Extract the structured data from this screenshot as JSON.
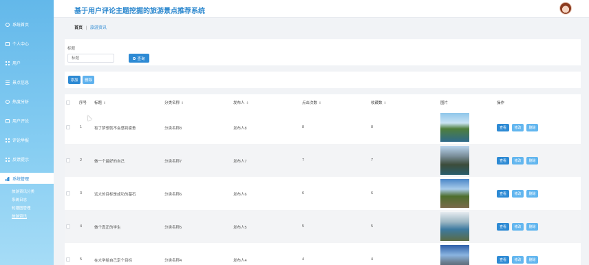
{
  "app_title": "基于用户评论主题挖掘的旅游景点推荐系统",
  "sidebar": {
    "items": [
      {
        "label": "系统首页",
        "icon": "home-icon"
      },
      {
        "label": "个人中心",
        "icon": "user-center-icon"
      },
      {
        "label": "用户",
        "icon": "grid-icon"
      },
      {
        "label": "景点信息",
        "icon": "list-icon"
      },
      {
        "label": "热度分析",
        "icon": "analysis-icon"
      },
      {
        "label": "用户评论",
        "icon": "comment-icon"
      },
      {
        "label": "评论举报",
        "icon": "grid-icon"
      },
      {
        "label": "反馈提示",
        "icon": "grid-icon"
      },
      {
        "label": "系统管理",
        "icon": "chart-icon"
      }
    ],
    "sub_items": [
      "旅游资讯分类",
      "系统日志",
      "轮播图管理",
      "旅游资讯"
    ]
  },
  "breadcrumb": {
    "home": "首页",
    "separator": "|",
    "current": "旅游资讯"
  },
  "search": {
    "label": "标题",
    "placeholder": "标题",
    "button": "查询"
  },
  "actions": {
    "add": "添加",
    "delete": "删除"
  },
  "table": {
    "headers": {
      "index": "序号",
      "title": "标题",
      "category": "分类名称",
      "publisher": "发布人",
      "clicks": "点击次数",
      "favorites": "收藏数",
      "image": "图片",
      "ops": "操作"
    },
    "ops": {
      "view": "查看",
      "edit": "修改",
      "delete": "删除"
    },
    "rows": [
      {
        "index": "1",
        "title": "有了梦想就不会感到疲惫",
        "category": "分类名称8",
        "publisher": "发布人8",
        "clicks": "8",
        "favorites": "8"
      },
      {
        "index": "2",
        "title": "做一个最好的自己",
        "category": "分类名称7",
        "publisher": "发布人7",
        "clicks": "7",
        "favorites": "7"
      },
      {
        "index": "3",
        "title": "远大的目标是成功的基石",
        "category": "分类名称6",
        "publisher": "发布人6",
        "clicks": "6",
        "favorites": "6"
      },
      {
        "index": "4",
        "title": "做个真正的学生",
        "category": "分类名称5",
        "publisher": "发布人5",
        "clicks": "5",
        "favorites": "5"
      },
      {
        "index": "5",
        "title": "在大学给自己定个目标",
        "category": "分类名称4",
        "publisher": "发布人4",
        "clicks": "4",
        "favorites": "4"
      }
    ]
  },
  "colors": {
    "primary": "#2d8ad4",
    "secondary": "#62b6ef",
    "sidebar_top": "#63b8ea",
    "sidebar_bottom": "#a6dcf6"
  }
}
